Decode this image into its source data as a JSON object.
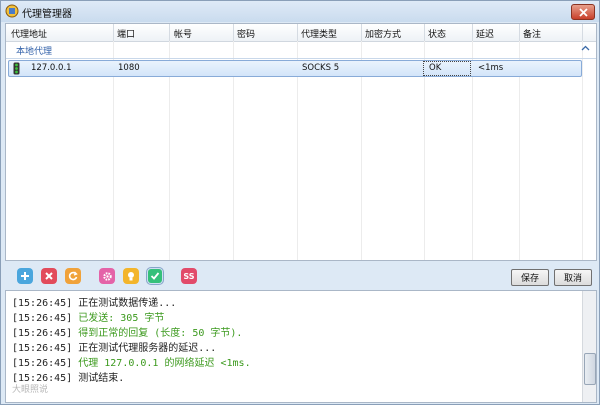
{
  "window": {
    "title": "代理管理器",
    "close_icon": "close-icon"
  },
  "grid": {
    "columns": [
      "代理地址",
      "端口",
      "帐号",
      "密码",
      "代理类型",
      "加密方式",
      "状态",
      "延迟",
      "备注"
    ],
    "group_label": "本地代理",
    "rows": [
      {
        "address": "127.0.0.1",
        "port": "1080",
        "account": "",
        "password": "",
        "type": "SOCKS 5",
        "encryption": "",
        "status": "OK",
        "latency": "<1ms",
        "note": ""
      }
    ]
  },
  "toolbar": {
    "icons": [
      "add-icon",
      "delete-icon",
      "refresh-icon",
      "settings-icon",
      "bulb-icon",
      "check-icon",
      "ss-icon"
    ],
    "ss_label": "SS",
    "save_label": "保存",
    "cancel_label": "取消"
  },
  "log": {
    "lines": [
      {
        "time": "[15:26:45]",
        "text": "正在测试数据传递...",
        "color": "#222222"
      },
      {
        "time": "[15:26:45]",
        "text": "已发送: 305 字节",
        "color": "#3c9a1e"
      },
      {
        "time": "[15:26:45]",
        "text": "得到正常的回复 (长度: 50 字节).",
        "color": "#3c9a1e"
      },
      {
        "time": "[15:26:45]",
        "text": "正在测试代理服务器的延迟...",
        "color": "#222222"
      },
      {
        "time": "[15:26:45]",
        "text": "代理 127.0.0.1 的网络延迟 <1ms.",
        "color": "#3c9a1e"
      },
      {
        "time": "[15:26:45]",
        "text": "测试结束.",
        "color": "#222222"
      }
    ],
    "watermark": "大眼照说"
  }
}
